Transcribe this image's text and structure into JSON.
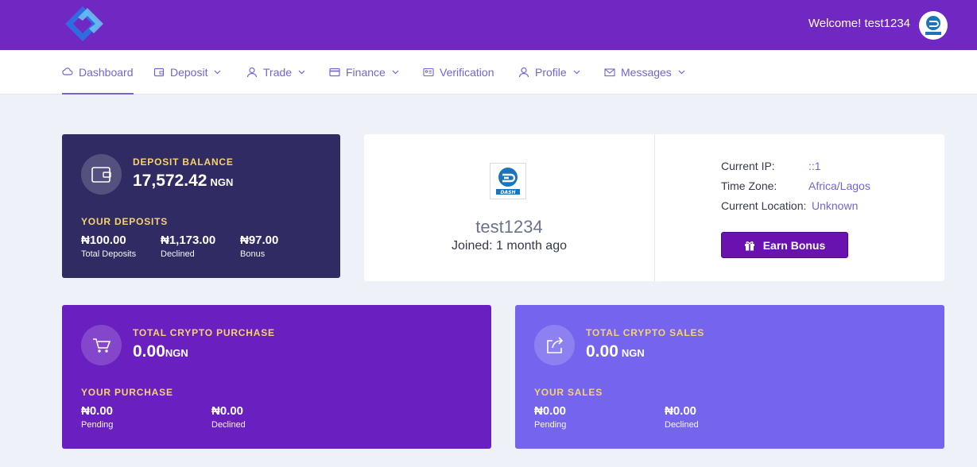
{
  "header": {
    "welcome": "Welcome! test1234",
    "avatar_icon": "dash-logo-icon",
    "brand_color": "#7127c2"
  },
  "nav": {
    "items": [
      {
        "label": "Dashboard",
        "icon": "cloud-icon",
        "active": true
      },
      {
        "label": "Deposit",
        "icon": "wallet-icon",
        "dropdown": true
      },
      {
        "label": "Trade",
        "icon": "user-icon",
        "dropdown": true
      },
      {
        "label": "Finance",
        "icon": "credit-card-icon",
        "dropdown": true
      },
      {
        "label": "Verification",
        "icon": "id-card-icon"
      },
      {
        "label": "Profile",
        "icon": "user-icon",
        "dropdown": true
      },
      {
        "label": "Messages",
        "icon": "envelope-icon",
        "dropdown": true
      }
    ]
  },
  "deposit": {
    "title": "DEPOSIT BALANCE",
    "amount": "17,572.42",
    "currency": "NGN",
    "sub_title": "YOUR DEPOSITS",
    "stats": [
      {
        "value": "₦100.00",
        "label": "Total Deposits"
      },
      {
        "value": "₦1,173.00",
        "label": "Declined"
      },
      {
        "value": "₦97.00",
        "label": "Bonus"
      }
    ]
  },
  "profile": {
    "username": "test1234",
    "joined": "Joined: 1 month ago",
    "current_ip_label": "Current IP:",
    "current_ip": "::1",
    "timezone_label": "Time Zone:",
    "timezone": "Africa/Lagos",
    "location_label": "Current Location:",
    "location": "Unknown",
    "earn_bonus": "Earn Bonus"
  },
  "purchase": {
    "title": "TOTAL CRYPTO PURCHASE",
    "amount": "0.00",
    "currency": "NGN",
    "sub_title": "YOUR PURCHASE",
    "stats": [
      {
        "value": "₦0.00",
        "label": "Pending"
      },
      {
        "value": "₦0.00",
        "label": "Declined"
      }
    ]
  },
  "sales": {
    "title": "TOTAL CRYPTO SALES",
    "amount": "0.00",
    "currency": "NGN",
    "sub_title": "YOUR SALES",
    "stats": [
      {
        "value": "₦0.00",
        "label": "Pending"
      },
      {
        "value": "₦0.00",
        "label": "Declined"
      }
    ]
  },
  "colors": {
    "deposit_card": "#302b63",
    "purchase_card": "#6a1fc0",
    "sales_card": "#7565ee",
    "accent": "#7065d4",
    "highlight": "#f6d36b"
  }
}
